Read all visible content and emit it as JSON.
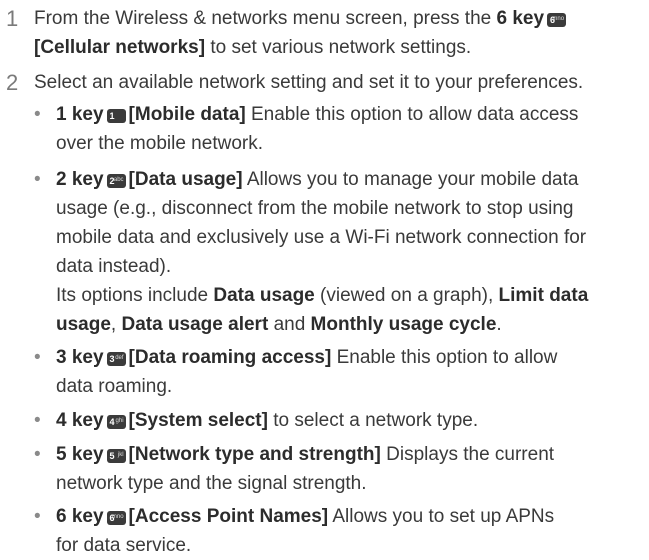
{
  "step1": {
    "number": "1",
    "line1_pre": "From the Wireless & networks menu screen, press the",
    "key_label": "6 key",
    "key_icon": {
      "digit": "6",
      "letters": "mno"
    },
    "line2_bold": "[Cellular networks]",
    "line2_post": "to set various network settings."
  },
  "step2": {
    "number": "2",
    "text": "Select an available network setting and set it to your preferences."
  },
  "bullets": [
    {
      "key_label": "1 key",
      "key_icon": {
        "digit": "1",
        "letters": ""
      },
      "title": "[Mobile data]",
      "first_rest": "Enable this option to allow data access",
      "more_lines": [
        "over the mobile network."
      ]
    },
    {
      "key_label": "2 key",
      "key_icon": {
        "digit": "2",
        "letters": "abc"
      },
      "title": "[Data usage]",
      "first_rest": "Allows you to manage your mobile data",
      "more_lines": [
        "usage (e.g., disconnect from the mobile network to stop using",
        "mobile data and exclusively use a Wi-Fi network connection for",
        "data instead)."
      ],
      "options": {
        "pre": "Its options include",
        "opt1": "Data usage",
        "mid1": "(viewed on a graph),",
        "opt2_line1": "Limit data",
        "opt2_line2": "usage",
        "sep": ",",
        "opt3": "Data usage alert",
        "and": "and",
        "opt4": "Monthly usage cycle",
        "end": "."
      }
    },
    {
      "key_label": "3 key",
      "key_icon": {
        "digit": "3",
        "letters": "def"
      },
      "title": "[Data roaming access]",
      "first_rest": "Enable this option to allow",
      "more_lines": [
        "data roaming."
      ]
    },
    {
      "key_label": "4 key",
      "key_icon": {
        "digit": "4",
        "letters": "ghi"
      },
      "title": "[System select]",
      "first_rest": "to select a network type.",
      "more_lines": []
    },
    {
      "key_label": "5 key",
      "key_icon": {
        "digit": "5",
        "letters": "jkl"
      },
      "title": "[Network type and strength]",
      "first_rest": "Displays the current",
      "more_lines": [
        "network type and the signal strength."
      ]
    },
    {
      "key_label": "6 key",
      "key_icon": {
        "digit": "6",
        "letters": "mno"
      },
      "title": "[Access Point Names]",
      "first_rest": "Allows you to set up APNs",
      "more_lines": [
        "for data service."
      ]
    }
  ]
}
